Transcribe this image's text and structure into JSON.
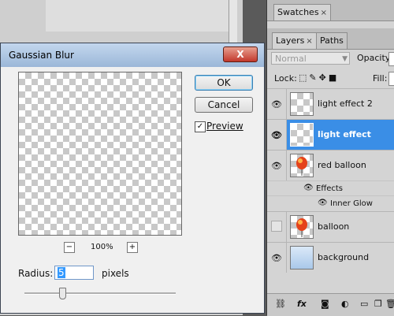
{
  "dialog": {
    "title": "Gaussian Blur",
    "close_label": "X",
    "ok_label": "OK",
    "cancel_label": "Cancel",
    "preview_label": "Preview",
    "preview_checked": true,
    "zoom_out_label": "−",
    "zoom_label": "100%",
    "zoom_in_label": "+",
    "radius_label": "Radius:",
    "radius_value": "5",
    "radius_unit": "pixels"
  },
  "swatches_panel": {
    "tab_label": "Swatches",
    "close_glyph": "×"
  },
  "layers_panel": {
    "tabs": [
      {
        "label": "Layers",
        "close_glyph": "×"
      },
      {
        "label": "Paths"
      }
    ],
    "blend_mode": "Normal",
    "opacity_label": "Opacity:",
    "lock_label": "Lock:",
    "fill_label": "Fill:",
    "layers": [
      {
        "name": "light effect 2",
        "visible": true
      },
      {
        "name": "light effect",
        "visible": true,
        "selected": true
      },
      {
        "name": "red balloon",
        "visible": true,
        "effects_label": "Effects",
        "effect": "Inner Glow"
      },
      {
        "name": "balloon",
        "visible": false
      },
      {
        "name": "background",
        "visible": true
      }
    ]
  },
  "colors": {
    "selection": "#3a8ee6",
    "balloon": "#e5421a"
  }
}
